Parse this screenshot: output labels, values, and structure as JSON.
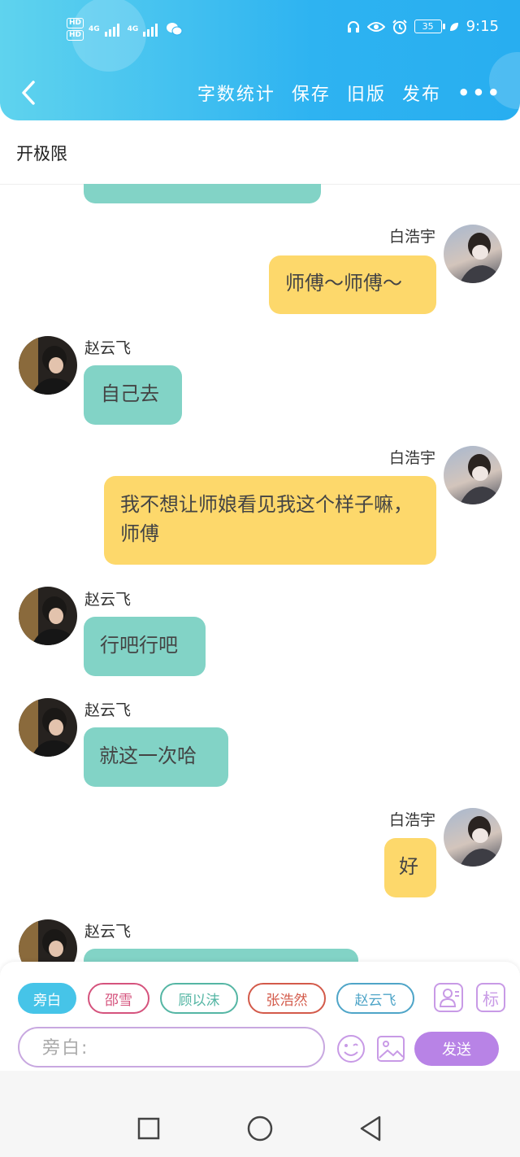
{
  "status_bar": {
    "left_labels": [
      "HD",
      "HD",
      "4G",
      "4G"
    ],
    "battery": "35",
    "time": "9:15"
  },
  "nav": {
    "actions": [
      "字数统计",
      "保存",
      "旧版",
      "发布"
    ],
    "more": "•••"
  },
  "story_title": "开极限",
  "messages": [
    {
      "side": "left",
      "name": "",
      "text": ""
    },
    {
      "side": "right",
      "name": "白浩宇",
      "text": "师傅～师傅～"
    },
    {
      "side": "left",
      "name": "赵云飞",
      "text": "自己去"
    },
    {
      "side": "right",
      "name": "白浩宇",
      "text": "我不想让师娘看见我这个样子嘛，师傅"
    },
    {
      "side": "left",
      "name": "赵云飞",
      "text": "行吧行吧"
    },
    {
      "side": "left",
      "name": "赵云飞",
      "text": "就这一次哈"
    },
    {
      "side": "right",
      "name": "白浩宇",
      "text": "好"
    },
    {
      "side": "left",
      "name": "赵云飞",
      "text": ""
    }
  ],
  "composer": {
    "chips": [
      {
        "label": "旁白",
        "color": "#46c4e8",
        "active": true
      },
      {
        "label": "邵雪",
        "color": "#d5537d",
        "active": false
      },
      {
        "label": "顾以沫",
        "color": "#55b6a4",
        "active": false
      },
      {
        "label": "张浩然",
        "color": "#d35a4a",
        "active": false
      },
      {
        "label": "赵云飞",
        "color": "#4fa5c8",
        "active": false
      }
    ],
    "mark_label": "标",
    "input_placeholder": "旁白:",
    "send_label": "发送"
  },
  "colors": {
    "header": "#2eb3f1",
    "left_bubble": "#82d3c6",
    "right_bubble": "#fdd86b",
    "send": "#b883e6"
  }
}
